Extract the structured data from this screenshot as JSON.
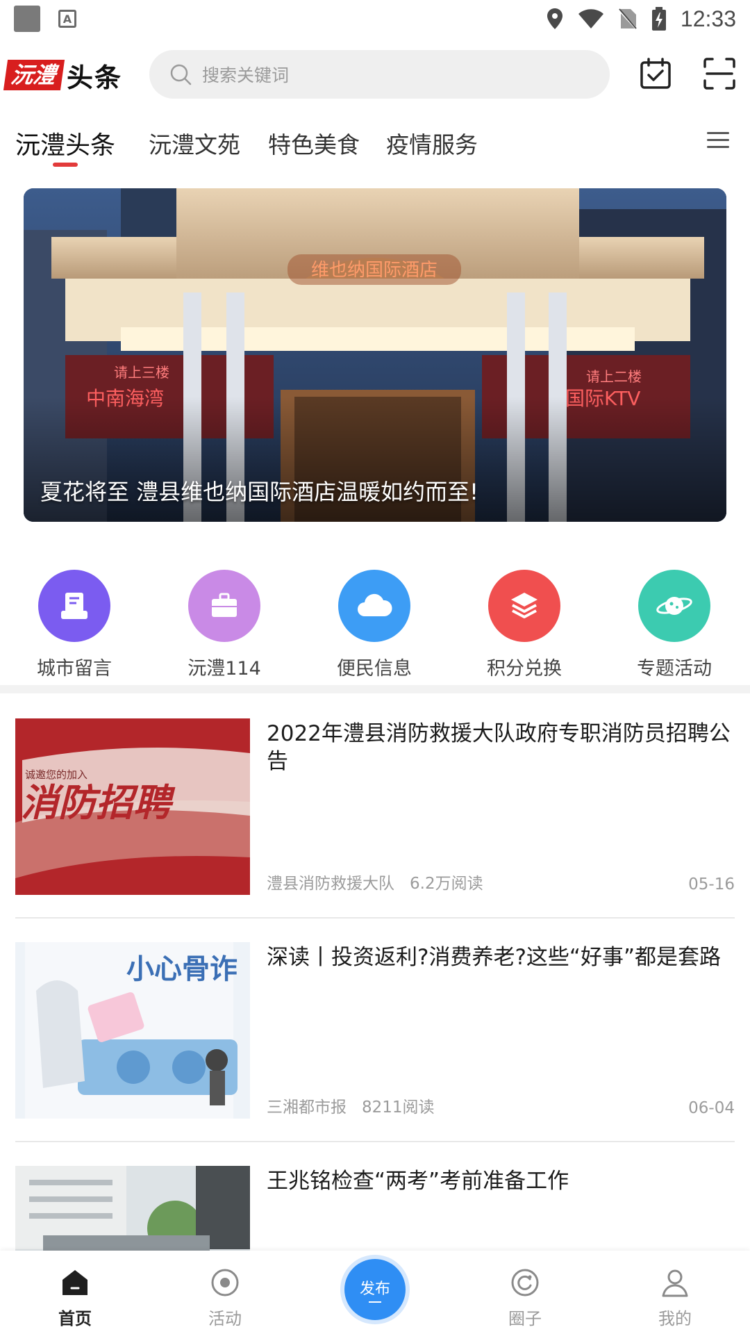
{
  "status_bar": {
    "time": "12:33"
  },
  "header": {
    "logo_part1": "沅澧",
    "logo_part2": "头条",
    "search_placeholder": "搜索关键词"
  },
  "tabs": [
    {
      "label": "沅澧头条",
      "active": true
    },
    {
      "label": "沅澧文苑",
      "active": false
    },
    {
      "label": "特色美食",
      "active": false
    },
    {
      "label": "疫情服务",
      "active": false
    }
  ],
  "banner": {
    "caption": "夏花将至 澧县维也纳国际酒店温暖如约而至!",
    "sign_main": "维也纳国际酒店",
    "sign_left_top": "请上三楼",
    "sign_left": "中南海湾",
    "sign_right_top": "请上二楼",
    "sign_right": "国际KTV"
  },
  "quick_links": [
    {
      "label": "城市留言",
      "icon": "message-board-icon",
      "color": "#7b5cf0"
    },
    {
      "label": "沅澧114",
      "icon": "briefcase-icon",
      "color": "#c98ae6"
    },
    {
      "label": "便民信息",
      "icon": "cloud-icon",
      "color": "#3d9df5"
    },
    {
      "label": "积分兑换",
      "icon": "layers-icon",
      "color": "#f04f4f"
    },
    {
      "label": "专题活动",
      "icon": "planet-icon",
      "color": "#3ccbb0"
    }
  ],
  "news": [
    {
      "title": "2022年澧县消防救援大队政府专职消防员招聘公告",
      "source": "澧县消防救援大队",
      "reads": "6.2万阅读",
      "date": "05-16",
      "thumb_small": "诚邀您的加入",
      "thumb_big": "消防招聘"
    },
    {
      "title": "深读丨投资返利?消费养老?这些“好事”都是套路",
      "source": "三湘都市报",
      "reads": "8211阅读",
      "date": "06-04",
      "thumb_big": "小心骨诈"
    },
    {
      "title": "王兆铭检查“两考”考前准备工作",
      "source": "",
      "reads": "",
      "date": ""
    }
  ],
  "bottom_nav": {
    "home": "首页",
    "activity": "活动",
    "publish": "发布",
    "circle": "圈子",
    "mine": "我的"
  }
}
